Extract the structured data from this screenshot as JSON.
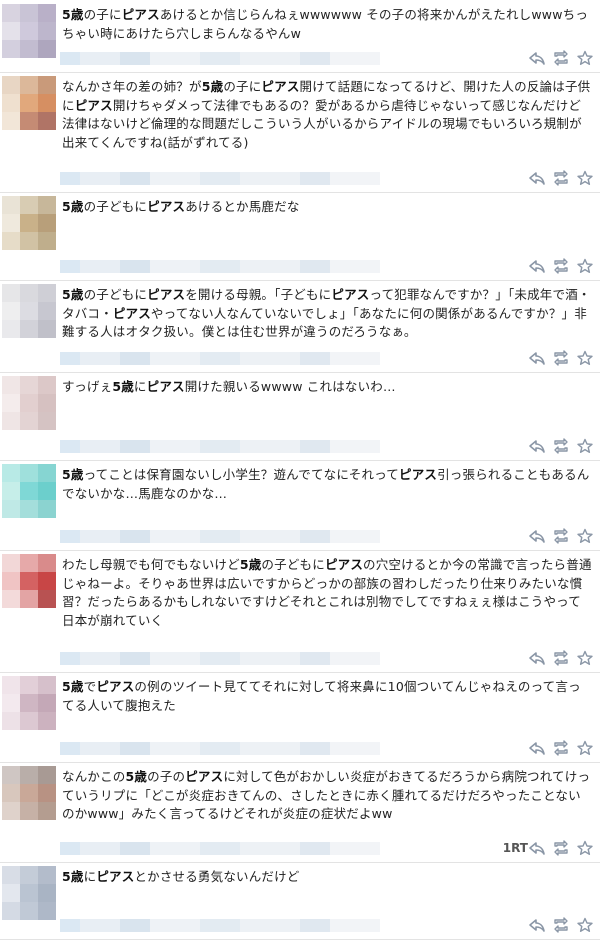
{
  "tweets": [
    {
      "text_parts": [
        [
          "5歳",
          1
        ],
        [
          "の子に",
          0
        ],
        [
          "ピアス",
          1
        ],
        [
          "あけるとか信じらんねぇwwwwww その子の将来かんがえたれしwwwちっちゃい時にあけたら穴しまらんなるやんw",
          0
        ]
      ]
    },
    {
      "text_parts": [
        [
          "なんかさ年の差の姉？が",
          0
        ],
        [
          "5歳",
          1
        ],
        [
          "の子に",
          0
        ],
        [
          "ピアス",
          1
        ],
        [
          "開けて話題になってるけど、開けた人の反論は子供に",
          0
        ],
        [
          "ピアス",
          1
        ],
        [
          "開けちゃダメって法律でもあるの？愛があるから虐待じゃないって感じなんだけど法律はないけど倫理的な問題だしこういう人がいるからアイドルの現場でもいろいろ規制が出来てくんですね(話がずれてる)",
          0
        ]
      ]
    },
    {
      "text_parts": [
        [
          "5歳",
          1
        ],
        [
          "の子どもに",
          0
        ],
        [
          "ピアス",
          1
        ],
        [
          "あけるとか馬鹿だな",
          0
        ]
      ]
    },
    {
      "text_parts": [
        [
          "5歳",
          1
        ],
        [
          "の子どもに",
          0
        ],
        [
          "ピアス",
          1
        ],
        [
          "を開ける母親。「子どもに",
          0
        ],
        [
          "ピアス",
          1
        ],
        [
          "って犯罪なんですか？」「未成年で酒・タバコ・",
          0
        ],
        [
          "ピアス",
          1
        ],
        [
          "やってない人なんていないでしょ」「あなたに何の関係があるんですか？」非難する人はオタク扱い。僕とは住む世界が違うのだろうなぁ。",
          0
        ]
      ]
    },
    {
      "text_parts": [
        [
          "すっげぇ",
          0
        ],
        [
          "5歳",
          1
        ],
        [
          "に",
          0
        ],
        [
          "ピアス",
          1
        ],
        [
          "開けた親いるwwww これはないわ…",
          0
        ]
      ]
    },
    {
      "text_parts": [
        [
          "5歳",
          1
        ],
        [
          "ってことは保育園ないし小学生？遊んでてなにそれって",
          0
        ],
        [
          "ピアス",
          1
        ],
        [
          "引っ張られることもあるんでないかな…馬鹿なのかな…",
          0
        ]
      ]
    },
    {
      "text_parts": [
        [
          "わたし母親でも何でもないけど",
          0
        ],
        [
          "5歳",
          1
        ],
        [
          "の子どもに",
          0
        ],
        [
          "ピアス",
          1
        ],
        [
          "の穴空けるとか今の常識で言ったら普通じゃねーよ。そりゃあ世界は広いですからどっかの部族の習わしだったり仕来りみたいな慣習？だったらあるかもしれないですけどそれとこれは別物でしてですねぇぇ様はこうやって日本が崩れていく",
          0
        ]
      ]
    },
    {
      "text_parts": [
        [
          "5歳",
          1
        ],
        [
          "で",
          0
        ],
        [
          "ピアス",
          1
        ],
        [
          "の例のツイート見ててそれに対して将来鼻に10個ついてんじゃねえのって言ってる人いて腹抱えた",
          0
        ]
      ]
    },
    {
      "text_parts": [
        [
          "なんかこの",
          0
        ],
        [
          "5歳",
          1
        ],
        [
          "の子の",
          0
        ],
        [
          "ピアス",
          1
        ],
        [
          "に対して色がおかしい炎症がおきてるだろうから病院つれてけっていうリプに「どこが炎症おきてんの、さしたときに赤く腫れてるだけだろやったことないのかwww」みたく言ってるけどそれが炎症の症状だよww",
          0
        ]
      ],
      "rt_count": "1RT"
    },
    {
      "text_parts": [
        [
          "5歳",
          1
        ],
        [
          "に",
          0
        ],
        [
          "ピアス",
          1
        ],
        [
          "とかさせる勇気ないんだけど",
          0
        ]
      ]
    }
  ],
  "icons": {
    "reply": "reply-icon",
    "retweet": "retweet-icon",
    "favorite": "star-icon"
  },
  "colors": {
    "text": "#222222",
    "meta_blur": "#e4ecf4",
    "icon": "#8a96a6",
    "divider": "#e3e3e3"
  }
}
